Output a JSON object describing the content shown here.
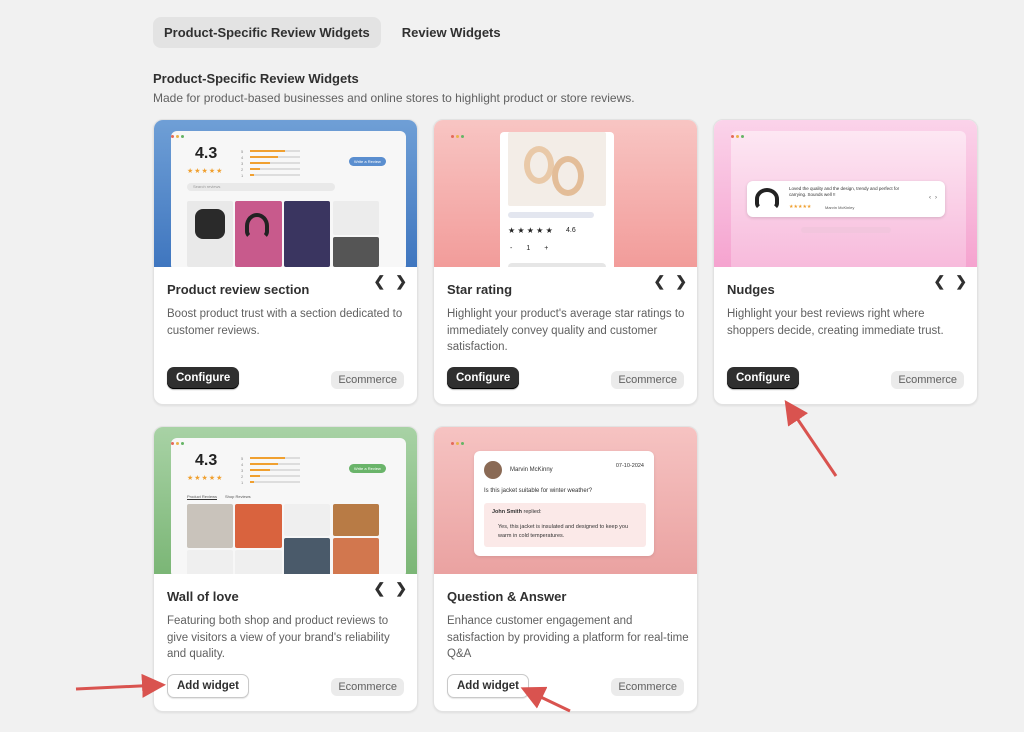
{
  "tabs": [
    {
      "label": "Product-Specific Review Widgets",
      "active": true
    },
    {
      "label": "Review Widgets",
      "active": false
    }
  ],
  "section": {
    "title": "Product-Specific Review Widgets",
    "description": "Made for product-based businesses and online stores to highlight product or store reviews."
  },
  "cards": [
    {
      "title": "Product review section",
      "description": "Boost product trust with a section dedicated to customer reviews.",
      "button": "Configure",
      "badge": "Ecommerce",
      "preview": {
        "rating": "4.3",
        "search_placeholder": "Search reviews",
        "cta": "Write a Review",
        "bg": "#4f84c8"
      }
    },
    {
      "title": "Star rating",
      "description": "Highlight your product's average star ratings to immediately convey quality and customer satisfaction.",
      "button": "Configure",
      "badge": "Ecommerce",
      "preview": {
        "stars": "★ ★ ★ ★ ★",
        "rating": "4.6",
        "qty_minus": "-",
        "qty": "1",
        "qty_plus": "+",
        "bg": "#f4a7a5"
      }
    },
    {
      "title": "Nudges",
      "description": "Highlight your best reviews right where shoppers decide, creating immediate trust.",
      "button": "Configure",
      "badge": "Ecommerce",
      "preview": {
        "quote": "Loved the quality and the design, trendy and perfect for carrying. Sounds well !!",
        "stars": "★★★★★",
        "author": "Marvin McKinley",
        "bg": "#f6a6d2"
      }
    },
    {
      "title": "Wall of love",
      "description": "Featuring both shop and product reviews to give visitors a view of your brand's reliability and quality.",
      "button": "Add widget",
      "badge": "Ecommerce",
      "preview": {
        "rating": "4.3",
        "tab1": "Product Reviews",
        "tab2": "Shop Reviews",
        "cta": "Write a Review",
        "bg": "#8cc088"
      }
    },
    {
      "title": "Question & Answer",
      "description": "Enhance customer engagement and satisfaction by providing a platform for real-time Q&A",
      "button": "Add widget",
      "badge": "Ecommerce",
      "preview": {
        "author": "Marvin McKinny",
        "date": "07-10-2024",
        "question": "Is this jacket suitable for winter weather?",
        "replier": "John Smith",
        "replied": "replied:",
        "answer": "Yes, this jacket is insulated and designed to keep you warm in cold temperatures.",
        "bg": "#eeaaa9"
      }
    }
  ],
  "nav": {
    "prev": "❮",
    "next": "❯"
  },
  "colors": {
    "annotation_arrow": "#d9534f",
    "dark_button": "#2f2f2f"
  }
}
